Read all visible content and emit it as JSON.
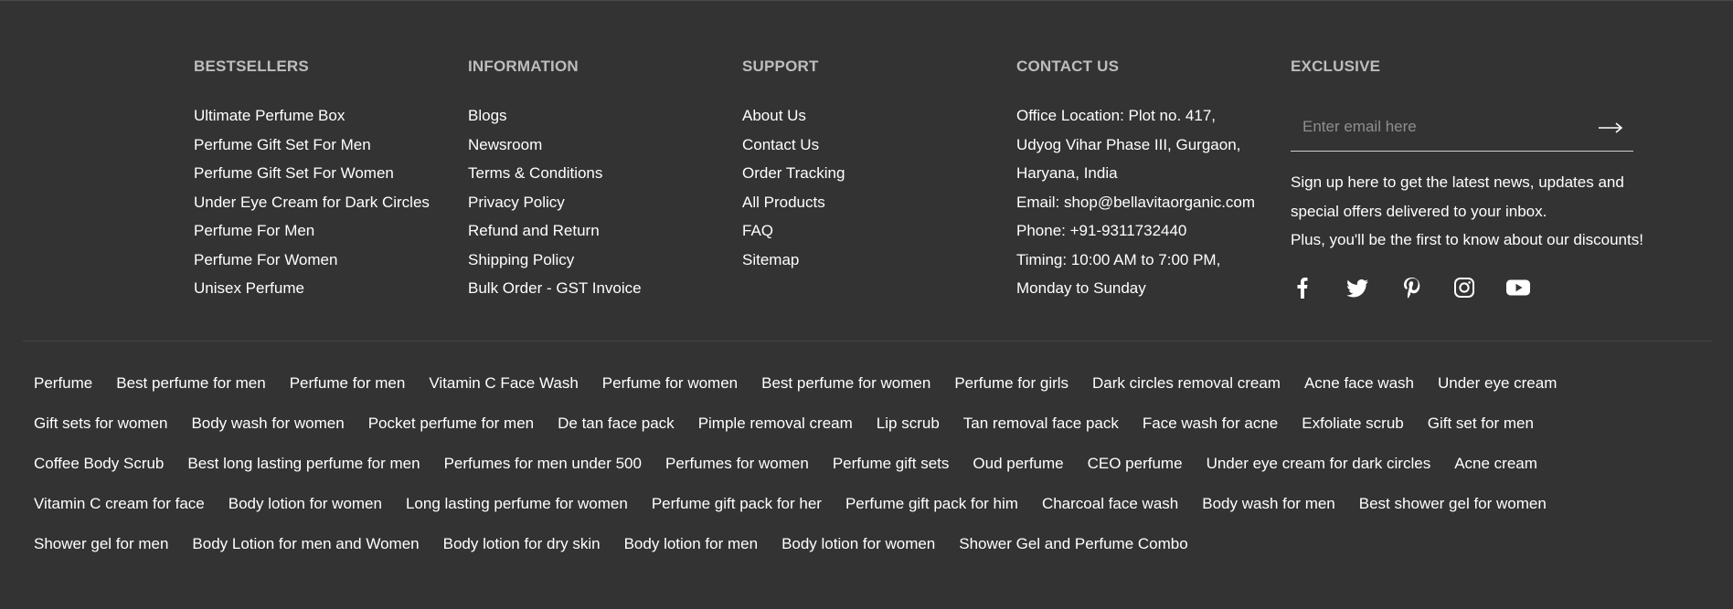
{
  "columns": {
    "bestsellers": {
      "title": "BESTSELLERS",
      "links": [
        "Ultimate Perfume Box",
        "Perfume Gift Set For Men",
        "Perfume Gift Set For Women",
        "Under Eye Cream for Dark Circles",
        "Perfume For Men",
        "Perfume For Women",
        "Unisex Perfume"
      ]
    },
    "information": {
      "title": "INFORMATION",
      "links": [
        "Blogs",
        "Newsroom",
        "Terms & Conditions",
        "Privacy Policy",
        "Refund and Return",
        "Shipping Policy",
        "Bulk Order - GST Invoice"
      ]
    },
    "support": {
      "title": "SUPPORT",
      "links": [
        "About Us",
        "Contact Us",
        "Order Tracking",
        "All Products",
        "FAQ",
        "Sitemap"
      ]
    },
    "contact": {
      "title": "CONTACT US",
      "lines": [
        "Office Location: Plot no. 417,",
        "Udyog Vihar Phase III, Gurgaon,",
        "Haryana, India",
        "Email: shop@bellavitaorganic.com",
        "Phone: +91-9311732440",
        "Timing: 10:00 AM to 7:00 PM,",
        "Monday to Sunday"
      ]
    },
    "exclusive": {
      "title": "EXCLUSIVE",
      "email_placeholder": "Enter email here",
      "submit_icon": "arrow-right-icon",
      "signup_lines": [
        "Sign up here to get the latest news, updates and",
        "special offers delivered to your inbox.",
        "Plus, you'll be the first to know about our discounts!"
      ],
      "social": [
        "facebook-icon",
        "twitter-icon",
        "pinterest-icon",
        "instagram-icon",
        "youtube-icon"
      ]
    }
  },
  "tag_rows": [
    [
      "Perfume",
      "Best perfume for men",
      "Perfume for men",
      "Vitamin C Face Wash",
      "Perfume for women",
      "Best perfume for women",
      "Perfume for girls",
      "Dark circles removal cream",
      "Acne face wash",
      "Under eye cream"
    ],
    [
      "Gift sets for women",
      "Body wash for women",
      "Pocket perfume for men",
      "De tan face pack",
      "Pimple removal cream",
      "Lip scrub",
      "Tan removal face pack",
      "Face wash for acne",
      "Exfoliate scrub",
      "Gift set for men"
    ],
    [
      "Coffee Body Scrub",
      "Best long lasting perfume for men",
      "Perfumes for men under 500",
      "Perfumes for women",
      "Perfume gift sets",
      "Oud perfume",
      "CEO perfume",
      "Under eye cream for dark circles",
      "Acne cream"
    ],
    [
      "Vitamin C cream for face",
      "Body lotion for women",
      "Long lasting perfume for women",
      "Perfume gift pack for her",
      "Perfume gift pack for him",
      "Charcoal face wash",
      "Body wash for men",
      "Best shower gel for women"
    ],
    [
      "Shower gel for men",
      "Body Lotion for men and Women",
      "Body lotion for dry skin",
      "Body lotion for men",
      "Body lotion for women",
      "Shower Gel and Perfume Combo"
    ]
  ],
  "colors": {
    "background": "#333333",
    "heading": "#bdbdbd",
    "text": "#ffffff",
    "placeholder": "#8e8e8e"
  }
}
